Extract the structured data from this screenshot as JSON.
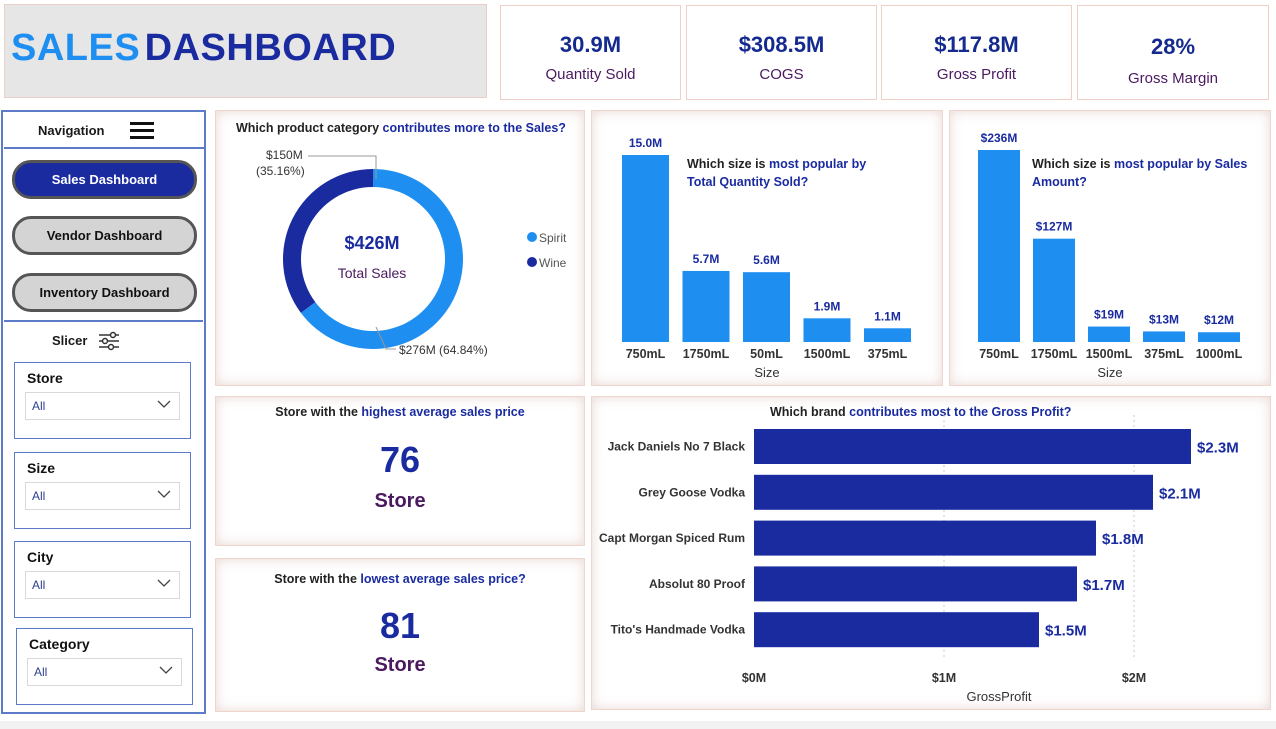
{
  "header": {
    "title_part1": "SALES",
    "title_part2": "DASHBOARD",
    "colors": {
      "part1": "#1f8ef1",
      "part2": "#1a2ba0"
    }
  },
  "kpis": [
    {
      "value": "30.9M",
      "label": "Quantity Sold"
    },
    {
      "value": "$308.5M",
      "label": "COGS"
    },
    {
      "value": "$117.8M",
      "label": "Gross Profit"
    },
    {
      "value": "28%",
      "label": "Gross Margin"
    }
  ],
  "navigation": {
    "label": "Navigation",
    "menu_icon": "hamburger-menu-icon",
    "buttons": [
      {
        "label": "Sales Dashboard",
        "active": true
      },
      {
        "label": "Vendor Dashboard",
        "active": false
      },
      {
        "label": "Inventory Dashboard",
        "active": false
      }
    ]
  },
  "slicer": {
    "label": "Slicer",
    "icon": "sliders-icon",
    "filters": [
      {
        "label": "Store",
        "value": "All"
      },
      {
        "label": "Size",
        "value": "All"
      },
      {
        "label": "City",
        "value": "All"
      },
      {
        "label": "Category",
        "value": "All"
      }
    ]
  },
  "category_chart": {
    "title_prefix": "Which product category ",
    "title_highlight": "contributes more to the Sales?",
    "center_value": "$426M",
    "center_label": "Total Sales",
    "label_wine_value": "$150M",
    "label_wine_pct": "(35.16%)",
    "label_spirit": "$276M (64.84%)",
    "legend": [
      "Spirit",
      "Wine"
    ],
    "colors": {
      "Spirit": "#1f8ef1",
      "Wine": "#1a2ba0"
    }
  },
  "qty_chart": {
    "title_prefix": "Which size is ",
    "title_highlight1": "most popular by",
    "title_highlight2": "Total Quantity Sold?",
    "xlabel": "Size",
    "bar_color": "#1f8ef1"
  },
  "sales_size_chart": {
    "title_prefix": "Which size is ",
    "title_highlight1": "most popular by Sales",
    "title_highlight2": "Amount?",
    "xlabel": "Size",
    "bar_color": "#1f8ef1"
  },
  "highest_store": {
    "title_prefix": "Store with the ",
    "title_highlight": "highest average sales price",
    "value": "76",
    "label": "Store"
  },
  "lowest_store": {
    "title_prefix": "Store with the ",
    "title_highlight": "lowest average sales price?",
    "value": "81",
    "label": "Store"
  },
  "brand_chart": {
    "title_prefix": "Which brand ",
    "title_highlight": "contributes most to the Gross Profit?",
    "xlabel": "GrossProfit",
    "bar_color": "#1a2ba0"
  },
  "chart_data": [
    {
      "type": "pie",
      "title": "Which product category contributes more to the Sales?",
      "categories": [
        "Spirit",
        "Wine"
      ],
      "values": [
        276,
        150
      ],
      "data_labels": [
        "$276M (64.84%)",
        "$150M (35.16%)"
      ]
    },
    {
      "type": "bar",
      "title": "Which size is most popular by Total Quantity Sold?",
      "xlabel": "Size",
      "categories": [
        "750mL",
        "1750mL",
        "50mL",
        "1500mL",
        "375mL"
      ],
      "values": [
        15.0,
        5.7,
        5.6,
        1.9,
        1.1
      ],
      "data_labels": [
        "15.0M",
        "5.7M",
        "5.6M",
        "1.9M",
        "1.1M"
      ],
      "ylim": [
        0,
        15.0
      ]
    },
    {
      "type": "bar",
      "title": "Which size is most popular by Sales Amount?",
      "xlabel": "Size",
      "categories": [
        "750mL",
        "1750mL",
        "1500mL",
        "375mL",
        "1000mL"
      ],
      "values": [
        236,
        127,
        19,
        13,
        12
      ],
      "data_labels": [
        "$236M",
        "$127M",
        "$19M",
        "$13M",
        "$12M"
      ],
      "ylim": [
        0,
        236
      ]
    },
    {
      "type": "bar",
      "orientation": "horizontal",
      "title": "Which brand contributes most to the Gross Profit?",
      "xlabel": "GrossProfit",
      "categories": [
        "Jack Daniels No 7 Black",
        "Grey Goose Vodka",
        "Capt Morgan Spiced Rum",
        "Absolut 80 Proof",
        "Tito's Handmade Vodka"
      ],
      "values": [
        2.3,
        2.1,
        1.8,
        1.7,
        1.5
      ],
      "data_labels": [
        "$2.3M",
        "$2.1M",
        "$1.8M",
        "$1.7M",
        "$1.5M"
      ],
      "xticks": [
        "$0M",
        "$1M",
        "$2M"
      ],
      "xlim": [
        0,
        2.0
      ]
    }
  ]
}
